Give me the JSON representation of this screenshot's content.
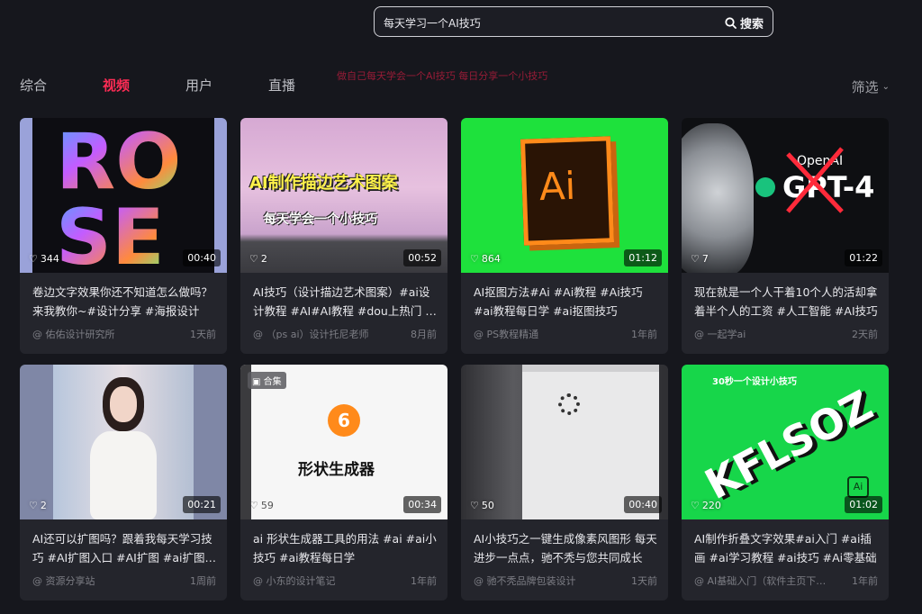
{
  "search": {
    "query": "每天学习一个AI技巧",
    "button_label": "搜索"
  },
  "tabs": [
    {
      "label": "综合",
      "active": false
    },
    {
      "label": "视频",
      "active": true
    },
    {
      "label": "用户",
      "active": false
    },
    {
      "label": "直播",
      "active": false
    }
  ],
  "overlay_watermark": "做自己每天学会一个AI技巧 每日分享一个小技巧",
  "filter": {
    "label": "筛选"
  },
  "colors": {
    "accent": "#fe2c55",
    "background": "#16171d",
    "card": "#24252c"
  },
  "videos": [
    {
      "likes": "344",
      "duration": "00:40",
      "title": "卷边文字效果你还不知道怎么做吗？来我教你~#设计分享 #海报设计",
      "author": "@ 佑佑设计研究所",
      "time": "1天前",
      "thumb_text": "ROSE"
    },
    {
      "likes": "2",
      "duration": "00:52",
      "title": "AI技巧（设计描边艺术图案）#ai设计教程 #AI#AI教程 #dou上热门 #设计",
      "author": "@ （ps ai）设计托尼老师",
      "time": "8月前",
      "thumb_text": "AI制作描边艺术图案",
      "thumb_subtext": "每天学会一个小技巧"
    },
    {
      "likes": "864",
      "duration": "01:12",
      "title": "AI抠图方法#Ai #Ai教程 #Ai技巧 #ai教程每日学 #ai抠图技巧",
      "author": "@ PS教程精通",
      "time": "1年前",
      "thumb_text": "Ai"
    },
    {
      "likes": "7",
      "duration": "01:22",
      "title": "现在就是一个人干着10个人的活却拿着半个人的工资 #人工智能 #AI技巧",
      "author": "@ 一起学ai",
      "time": "2天前",
      "thumb_text": "GPT-4",
      "thumb_subtext": "OpenAI"
    },
    {
      "likes": "2",
      "duration": "00:21",
      "title": "AI还可以扩图吗？跟着我每天学习技巧 #AI扩图入口 #AI扩图 #ai扩图教程",
      "author": "@ 资源分享站",
      "time": "1周前"
    },
    {
      "likes": "59",
      "duration": "00:34",
      "title": "ai 形状生成器工具的用法 #ai #ai小技巧 #ai教程每日学",
      "author": "@ 小东的设计笔记",
      "time": "1年前",
      "badge": "合集",
      "thumb_number": "6",
      "thumb_text": "形状生成器"
    },
    {
      "likes": "50",
      "duration": "00:40",
      "title": "AI小技巧之一键生成像素风图形 每天进步一点点，驰不秃与您共同成长",
      "author": "@ 驰不秃品牌包装设计",
      "time": "1天前"
    },
    {
      "likes": "220",
      "duration": "01:02",
      "title": "AI制作折叠文字效果#ai入门 #ai插画 #ai学习教程 #ai技巧 #Ai零基础",
      "author": "@ AI基础入门（软件主页下载）",
      "time": "1年前",
      "thumb_text": "KFLSOZ",
      "thumb_subtext": "30秒一个设计小技巧"
    }
  ]
}
